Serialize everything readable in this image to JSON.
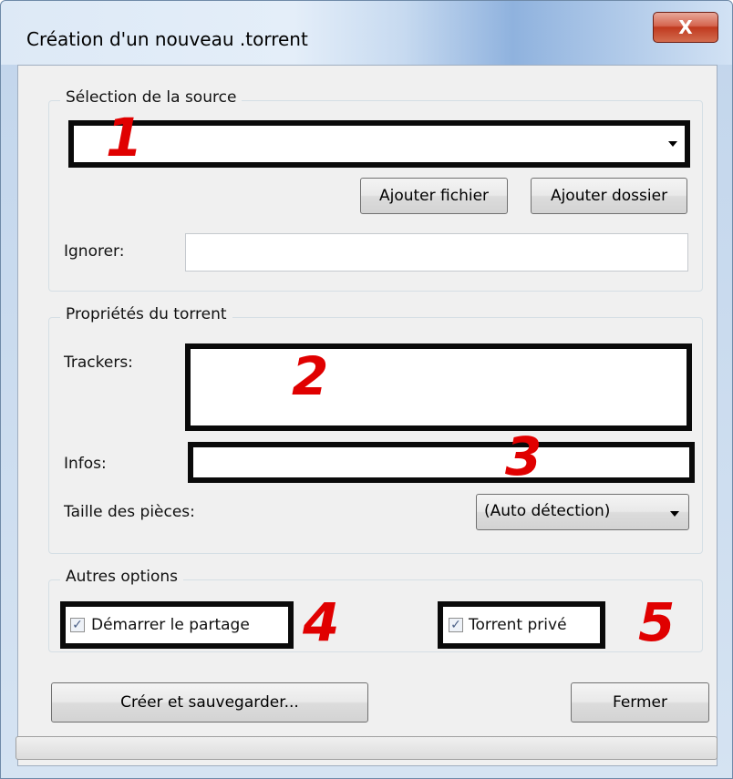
{
  "window": {
    "title": "Création d'un nouveau .torrent",
    "close_label": "X"
  },
  "source": {
    "legend": "Sélection de la source",
    "marker": "1",
    "add_file_label": "Ajouter fichier",
    "add_folder_label": "Ajouter dossier",
    "ignore_label": "Ignorer:",
    "ignore_value": ""
  },
  "properties": {
    "legend": "Propriétés du torrent",
    "trackers_label": "Trackers:",
    "trackers_marker": "2",
    "infos_label": "Infos:",
    "infos_marker": "3",
    "piece_size_label": "Taille des pièces:",
    "piece_size_value": "(Auto détection)"
  },
  "options": {
    "legend": "Autres options",
    "start_seeding_label": "Démarrer le partage",
    "start_seeding_checked": true,
    "start_seeding_marker": "4",
    "private_label": "Torrent privé",
    "private_checked": true,
    "private_marker": "5"
  },
  "actions": {
    "create_label": "Créer et sauvegarder...",
    "close_label": "Fermer"
  }
}
